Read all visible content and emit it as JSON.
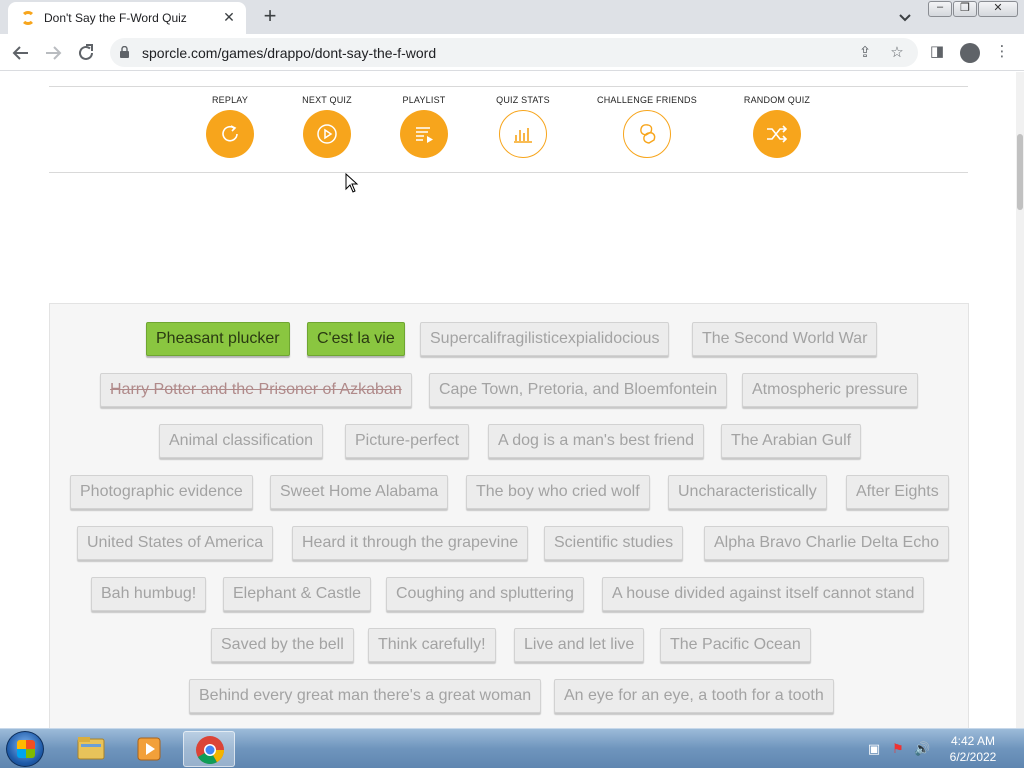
{
  "browser": {
    "tab_title": "Don't Say the F-Word Quiz",
    "tab_close": "✕",
    "new_tab": "+",
    "url": "sporcle.com/games/drappo/dont-say-the-f-word"
  },
  "quiz_toolbar": {
    "replay": "REPLAY",
    "next_quiz": "NEXT QUIZ",
    "playlist": "PLAYLIST",
    "quiz_stats": "QUIZ STATS",
    "challenge_friends": "CHALLENGE FRIENDS",
    "random_quiz": "RANDOM QUIZ"
  },
  "answers": [
    "Pheasant plucker",
    "C'est la vie",
    "Supercalifragilisticexpialidocious",
    "The Second World War",
    "Harry Potter and the Prisoner of Azkaban",
    "Cape Town, Pretoria, and Bloemfontein",
    "Atmospheric pressure",
    "Animal classification",
    "Picture-perfect",
    "A dog is a man's best friend",
    "The Arabian Gulf",
    "Photographic evidence",
    "Sweet Home Alabama",
    "The boy who cried wolf",
    "Uncharacteristically",
    "After Eights",
    "United States of America",
    "Heard it through the grapevine",
    "Scientific studies",
    "Alpha Bravo Charlie Delta Echo",
    "Bah humbug!",
    "Elephant & Castle",
    "Coughing and spluttering",
    "A house divided against itself cannot stand",
    "Saved by the bell",
    "Think carefully!",
    "Live and let live",
    "The Pacific Ocean",
    "Behind every great man there's a great woman",
    "An eye for an eye, a tooth for a tooth"
  ],
  "answer_states": {
    "found": [
      "Pheasant plucker",
      "C'est la vie"
    ],
    "struck": [
      "Harry Potter and the Prisoner of Azkaban"
    ]
  },
  "colors": {
    "accent": "#f7a51c",
    "found": "#8ac640"
  },
  "taskbar": {
    "time": "4:42 AM",
    "date": "6/2/2022"
  }
}
